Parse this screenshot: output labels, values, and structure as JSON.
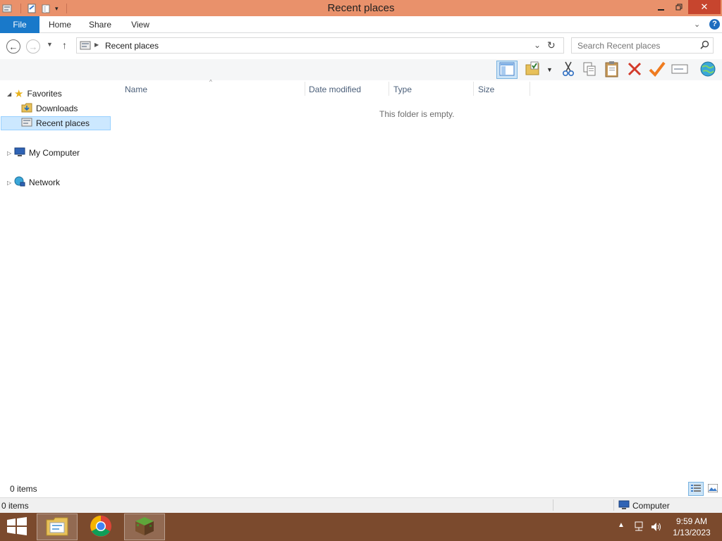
{
  "window": {
    "title": "Recent places"
  },
  "ribbon": {
    "tabs": [
      "File",
      "Home",
      "Share",
      "View"
    ]
  },
  "address": {
    "path": "Recent places"
  },
  "search": {
    "placeholder": "Search Recent places"
  },
  "nav": {
    "favorites": "Favorites",
    "downloads": "Downloads",
    "recent": "Recent places",
    "computer": "My Computer",
    "network": "Network"
  },
  "columns": [
    "Name",
    "Date modified",
    "Type",
    "Size"
  ],
  "content": {
    "empty_message": "This folder is empty."
  },
  "status": {
    "items": "0 items",
    "items_bottom": "0 items",
    "location": "Computer"
  },
  "taskbar": {
    "time": "9:59 AM",
    "date": "1/13/2023"
  },
  "colors": {
    "titlebar": "#e9916b",
    "file_tab": "#1979ca",
    "close": "#c7452e",
    "taskbar": "#7b4a2d",
    "selection": "#cce8ff"
  },
  "icons": [
    "recent-places-icon",
    "properties-icon",
    "folder-icon",
    "qa-dropdown-icon",
    "minimize-icon",
    "restore-icon",
    "close-icon",
    "help-icon",
    "back-icon",
    "forward-icon",
    "recent-dropdown-icon",
    "up-icon",
    "refresh-icon",
    "search-icon",
    "preview-pane-icon",
    "folder-check-icon",
    "cut-icon",
    "copy-icon",
    "paste-icon",
    "delete-icon",
    "checkmark-icon",
    "rename-icon",
    "globe-icon",
    "star-icon",
    "downloads-folder-icon",
    "computer-icon",
    "network-icon",
    "details-view-icon",
    "large-icons-view-icon",
    "start-icon",
    "file-explorer-icon",
    "chrome-icon",
    "minecraft-icon"
  ]
}
